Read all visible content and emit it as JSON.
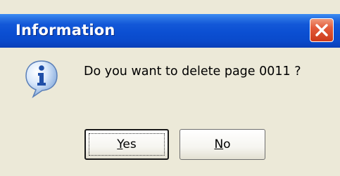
{
  "window": {
    "title": "Information"
  },
  "dialog": {
    "icon": "information-icon",
    "message": "Do you want to delete page 0011 ?"
  },
  "buttons": {
    "yes": {
      "mnemonic": "Y",
      "rest": "es",
      "default": true
    },
    "no": {
      "mnemonic": "N",
      "rest": "o",
      "default": false
    }
  },
  "colors": {
    "titlebar": "#0a4acb",
    "close_button": "#e35b3a",
    "dialog_background": "#ece9d8"
  }
}
